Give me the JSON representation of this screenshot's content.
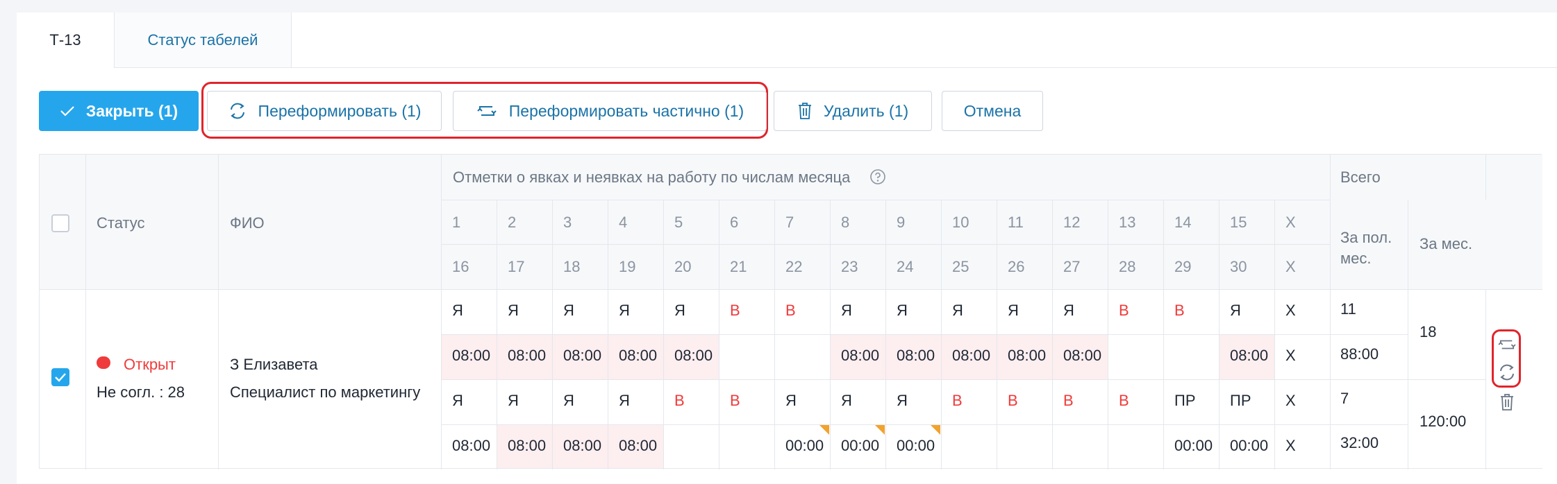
{
  "tabs": [
    {
      "label": "Т-13",
      "active": true
    },
    {
      "label": "Статус табелей",
      "active": false
    }
  ],
  "toolbar": {
    "close_label": "Закрыть (1)",
    "reform_label": "Переформировать (1)",
    "reform_partial_label": "Переформировать частично (1)",
    "delete_label": "Удалить (1)",
    "cancel_label": "Отмена"
  },
  "colors": {
    "accent": "#25a6ec",
    "link": "#1a73a8",
    "weekend_red": "#ef3b3b",
    "highlight_red": "#e0242b",
    "pink_cell": "#fdeef0",
    "corner_mark": "#f2a22d"
  },
  "table": {
    "headers": {
      "status": "Статус",
      "name": "ФИО",
      "marks": "Отметки о явках и неявках на работу по числам месяца",
      "total": "Всего",
      "half_month": "За пол. мес.",
      "month": "За мес."
    },
    "days_row1": [
      "1",
      "2",
      "3",
      "4",
      "5",
      "6",
      "7",
      "8",
      "9",
      "10",
      "11",
      "12",
      "13",
      "14",
      "15",
      "X"
    ],
    "days_row2": [
      "16",
      "17",
      "18",
      "19",
      "20",
      "21",
      "22",
      "23",
      "24",
      "25",
      "26",
      "27",
      "28",
      "29",
      "30",
      "X"
    ],
    "row": {
      "checked": true,
      "status": "Открыт",
      "status_note": "Не согл. : 28",
      "name": "З Елизавета",
      "position": "Специалист по маркетингу",
      "marks_row1": [
        "Я",
        "Я",
        "Я",
        "Я",
        "Я",
        "В",
        "В",
        "Я",
        "Я",
        "Я",
        "Я",
        "Я",
        "В",
        "В",
        "Я",
        "Х"
      ],
      "hours_row1": [
        "08:00",
        "08:00",
        "08:00",
        "08:00",
        "08:00",
        "",
        "",
        "08:00",
        "08:00",
        "08:00",
        "08:00",
        "08:00",
        "",
        "",
        "08:00",
        "Х"
      ],
      "marks_row2": [
        "Я",
        "Я",
        "Я",
        "Я",
        "В",
        "В",
        "Я",
        "Я",
        "Я",
        "В",
        "В",
        "В",
        "В",
        "ПР",
        "ПР",
        "Х"
      ],
      "hours_row2": [
        "08:00",
        "08:00",
        "08:00",
        "08:00",
        "",
        "",
        "00:00",
        "00:00",
        "00:00",
        "",
        "",
        "",
        "",
        "00:00",
        "00:00",
        "Х"
      ],
      "half1_days": "11",
      "half1_hours": "88:00",
      "half2_days": "7",
      "half2_hours": "32:00",
      "month_days": "18",
      "month_hours": "120:00"
    }
  }
}
